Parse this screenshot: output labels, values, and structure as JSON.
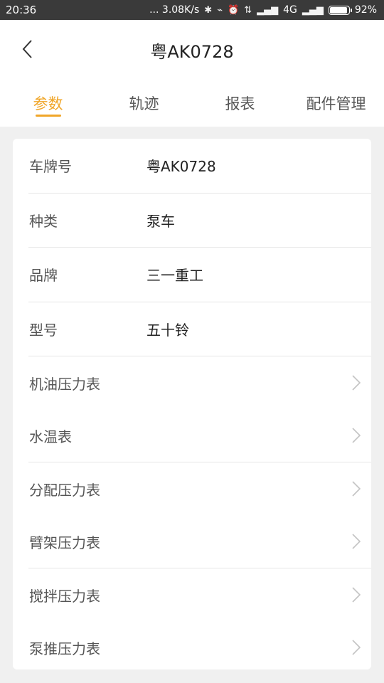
{
  "status_bar": {
    "time": "20:36",
    "net_speed": "... 3.08K/s",
    "network": "4G",
    "battery": "92%",
    "battery_level": 0.92
  },
  "header": {
    "title": "粤AK0728"
  },
  "tabs": [
    {
      "label": "参数",
      "active": true
    },
    {
      "label": "轨迹",
      "active": false
    },
    {
      "label": "报表",
      "active": false
    },
    {
      "label": "配件管理",
      "active": false
    }
  ],
  "info": [
    {
      "label": "车牌号",
      "value": "粤AK0728"
    },
    {
      "label": "种类",
      "value": "泵车"
    },
    {
      "label": "品牌",
      "value": "三一重工"
    },
    {
      "label": "型号",
      "value": "五十铃"
    }
  ],
  "gauges": [
    {
      "label": "机油压力表"
    },
    {
      "label": "水温表"
    },
    {
      "label": "分配压力表"
    },
    {
      "label": "臂架压力表"
    },
    {
      "label": "搅拌压力表"
    },
    {
      "label": "泵推压力表"
    }
  ],
  "icons": {
    "back": "chevron-left-icon",
    "row_arrow": "chevron-right-icon"
  },
  "colors": {
    "accent": "#f0a629",
    "status_bar": "#3a3a3a",
    "background": "#f0f0f0"
  }
}
